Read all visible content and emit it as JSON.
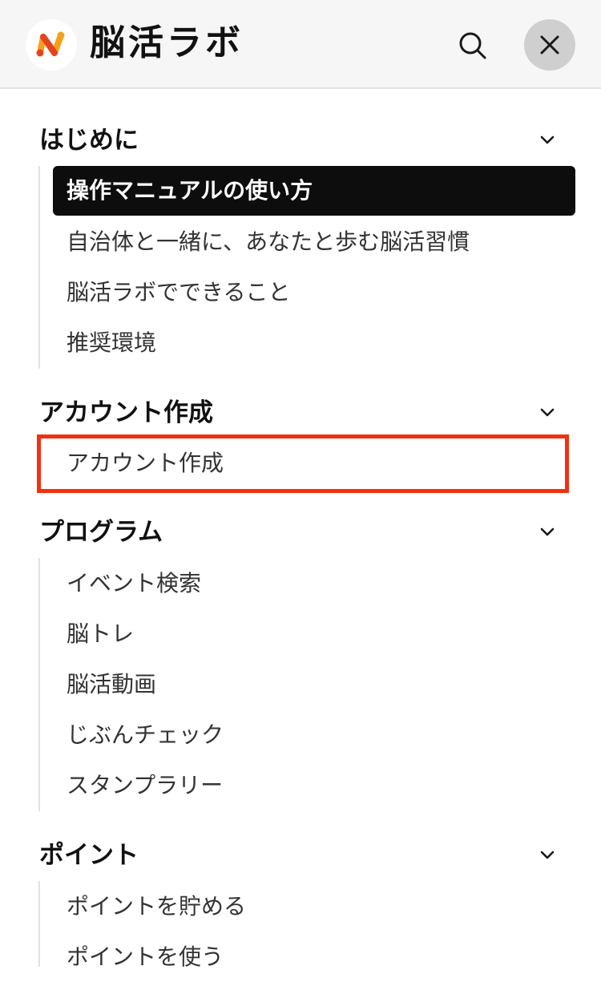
{
  "header": {
    "brand_name": "脳活ラボ",
    "logo_icon": "brain-lab-logo-icon",
    "search_icon": "search-icon",
    "close_icon": "close-icon",
    "colors": {
      "background": "#f6f6f6",
      "close_button_bg": "#cfcfcf",
      "logo_orange": "#f5a01a",
      "logo_red": "#e5421f"
    }
  },
  "menu": {
    "sections": [
      {
        "title": "はじめに",
        "items": [
          {
            "label": "操作マニュアルの使い方",
            "active": true
          },
          {
            "label": "自治体と一緒に、あなたと歩む脳活習慣"
          },
          {
            "label": "脳活ラボでできること"
          },
          {
            "label": "推奨環境"
          }
        ]
      },
      {
        "title": "アカウント作成",
        "items": [
          {
            "label": "アカウント作成",
            "highlighted": true
          }
        ]
      },
      {
        "title": "プログラム",
        "items": [
          {
            "label": "イベント検索"
          },
          {
            "label": "脳トレ"
          },
          {
            "label": "脳活動画"
          },
          {
            "label": "じぶんチェック"
          },
          {
            "label": "スタンプラリー"
          }
        ]
      },
      {
        "title": "ポイント",
        "items": [
          {
            "label": "ポイントを貯める"
          },
          {
            "label": "ポイントを使う"
          }
        ]
      }
    ],
    "chevron_icon": "chevron-down-icon",
    "colors": {
      "active_bg": "#0d0d0d",
      "active_text": "#ffffff",
      "highlight_border": "#f33010",
      "rail": "#e2e2e2"
    }
  }
}
